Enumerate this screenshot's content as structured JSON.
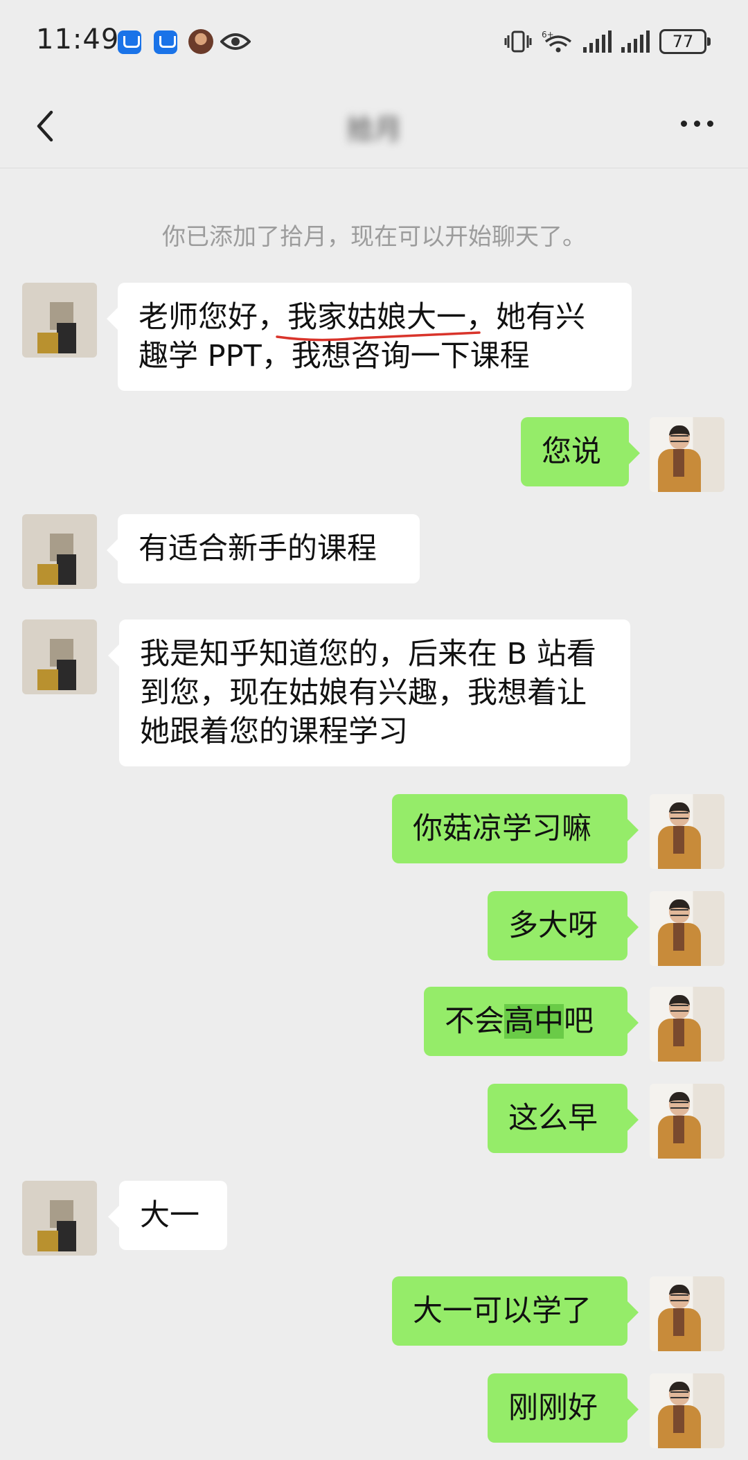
{
  "status_bar": {
    "time": "11:49",
    "network": "6+",
    "battery": "77"
  },
  "nav": {
    "title": "拾月",
    "back_icon": "chevron-left-icon",
    "more_icon": "more-dots-icon"
  },
  "system_message": "你已添加了拾月，现在可以开始聊天了。",
  "messages": [
    {
      "from": "other",
      "text": "老师您好，我家姑娘大一，她有兴趣学 PPT，我想咨询一下课程"
    },
    {
      "from": "self",
      "text": "您说"
    },
    {
      "from": "other",
      "text": "有适合新手的课程"
    },
    {
      "from": "other",
      "text": "我是知乎知道您的，后来在 B 站看到您，现在姑娘有兴趣，我想着让她跟着您的课程学习"
    },
    {
      "from": "self",
      "text": "你菇凉学习嘛"
    },
    {
      "from": "self",
      "text": "多大呀"
    },
    {
      "from": "self",
      "text": "不会高中吧",
      "parts": [
        "不会",
        "高中",
        "吧"
      ]
    },
    {
      "from": "self",
      "text": "这么早"
    },
    {
      "from": "other",
      "text": "大一"
    },
    {
      "from": "self",
      "text": "大一可以学了"
    },
    {
      "from": "self",
      "text": "刚刚好"
    }
  ],
  "colors": {
    "background": "#ededed",
    "self_bubble": "#95ec69",
    "other_bubble": "#ffffff",
    "underline": "#d9342b"
  }
}
